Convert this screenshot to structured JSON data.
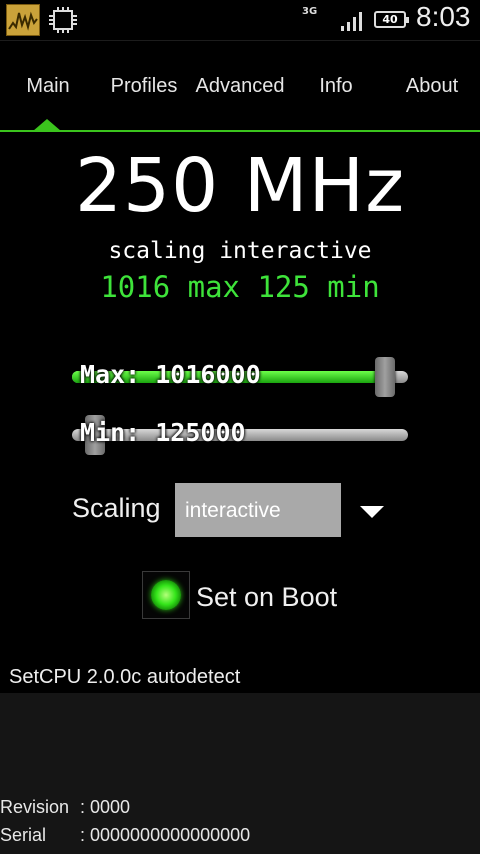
{
  "status_bar": {
    "network": "3G",
    "battery": "40",
    "time": "8:03",
    "icons": [
      "setcpu-app-icon",
      "cpu-chip-icon",
      "signal-icon",
      "battery-icon"
    ]
  },
  "tabs": [
    {
      "label": "Main",
      "selected": true
    },
    {
      "label": "Profiles",
      "selected": false
    },
    {
      "label": "Advanced",
      "selected": false
    },
    {
      "label": "Info",
      "selected": false
    },
    {
      "label": "About",
      "selected": false
    }
  ],
  "main": {
    "current_frequency": "250 MHz",
    "scaling_line": "scaling interactive",
    "minmax_line": "1016 max 125 min",
    "max_slider": {
      "label": "Max: 1016000",
      "value_fraction": 0.96
    },
    "min_slider": {
      "label": "Min: 125000",
      "value_fraction": 0.04
    },
    "scaling_label": "Scaling",
    "scaling_selected": "interactive",
    "set_on_boot_label": "Set on Boot",
    "set_on_boot_checked": true,
    "version_text": "SetCPU 2.0.0c autodetect"
  },
  "info_panel": {
    "rows": [
      {
        "key": "Revision",
        "value": ": 0000"
      },
      {
        "key": "Serial",
        "value": ": 0000000000000000"
      }
    ]
  },
  "colors": {
    "accent": "#3bc41d",
    "minmax_text": "#3ee33a",
    "background": "#000000"
  }
}
